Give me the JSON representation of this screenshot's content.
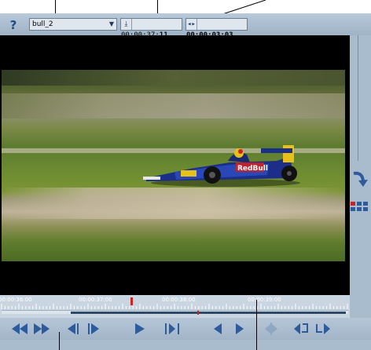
{
  "toolbar": {
    "help_label": "?",
    "clip_name": "bull_2",
    "current_timecode_prefix": "00:00:37:",
    "current_timecode_frames": "11",
    "duration_timecode": "00:00:03:03"
  },
  "timeline": {
    "ruler_labels": [
      "00:00:36:00",
      "00:00:37:00",
      "00:00:38:00",
      "00:00:39:00"
    ]
  },
  "icons": {
    "help": "question-mark-icon",
    "dropdown": "chevron-down-icon",
    "mark_in": "set-in-point-icon",
    "duration": "duration-icon",
    "refresh": "curved-arrow-icon",
    "grid": "grid-view-icon",
    "rewind": "rewind-icon",
    "fast_forward": "fast-forward-icon",
    "step_back": "step-back-icon",
    "step_forward": "step-forward-icon",
    "play": "play-icon",
    "play_in_out": "play-in-to-out-icon",
    "mark_in_btn": "mark-in-icon",
    "mark_out_btn": "mark-out-icon",
    "split": "split-icon",
    "go_to_in": "go-to-in-icon",
    "go_to_out": "go-to-out-icon"
  },
  "colors": {
    "panel": "#a9bccd",
    "icon_blue": "#2d5b9b",
    "playhead": "#cc2222"
  }
}
